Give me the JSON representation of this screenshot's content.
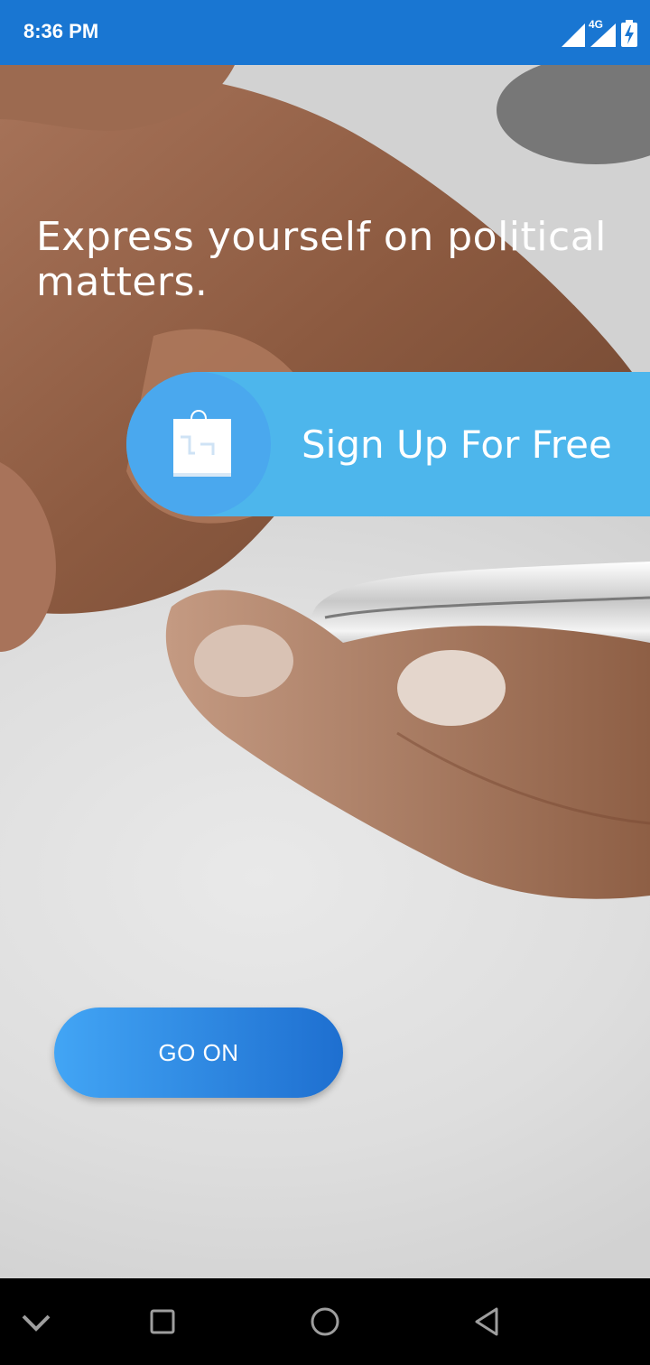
{
  "status_bar": {
    "time": "8:36 PM",
    "network": "4G",
    "icons": [
      "signal-icon",
      "signal-4g-icon",
      "battery-charging-icon"
    ]
  },
  "main": {
    "headline": "Express yourself on political matters.",
    "signup": {
      "label": "Sign Up For Free",
      "icon": "shopping-bag-icon"
    },
    "go_on_label": "GO ON"
  },
  "nav_bar": {
    "icons": [
      "chevron-down-icon",
      "recents-square-icon",
      "home-circle-icon",
      "back-triangle-icon"
    ]
  },
  "colors": {
    "status_bar": "#1976d2",
    "signup_banner": "#4db6ec",
    "signup_circle": "#4aa8ee",
    "button_gradient_start": "#42a5f5",
    "button_gradient_end": "#1e6fd0",
    "nav_bar": "#000000"
  }
}
